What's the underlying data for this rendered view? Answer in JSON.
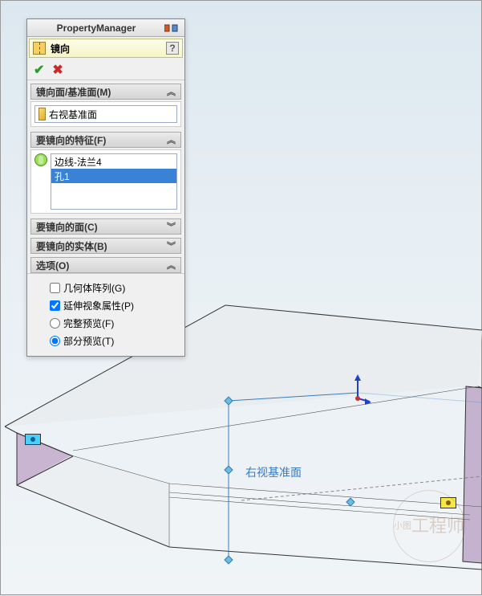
{
  "pm": {
    "title": "PropertyManager",
    "feature_label": "镜向",
    "help": "?",
    "sections": {
      "mirror_face": {
        "title": "镜向面/基准面(M)",
        "value": "右视基准面"
      },
      "features": {
        "title": "要镜向的特征(F)",
        "items": [
          "边线-法兰4",
          "孔1"
        ],
        "selected_index": 1
      },
      "faces": {
        "title": "要镜向的面(C)"
      },
      "bodies": {
        "title": "要镜向的实体(B)"
      },
      "options": {
        "title": "选项(O)",
        "geometry_pattern": {
          "label": "几何体阵列(G)",
          "checked": false
        },
        "propagate": {
          "label": "延伸视象属性(P)",
          "checked": true
        },
        "full_preview": {
          "label": "完整预览(F)",
          "selected": false
        },
        "partial_preview": {
          "label": "部分预览(T)",
          "selected": true
        }
      }
    }
  },
  "viewport": {
    "plane_label": "右视基准面",
    "watermark": "工程师"
  }
}
